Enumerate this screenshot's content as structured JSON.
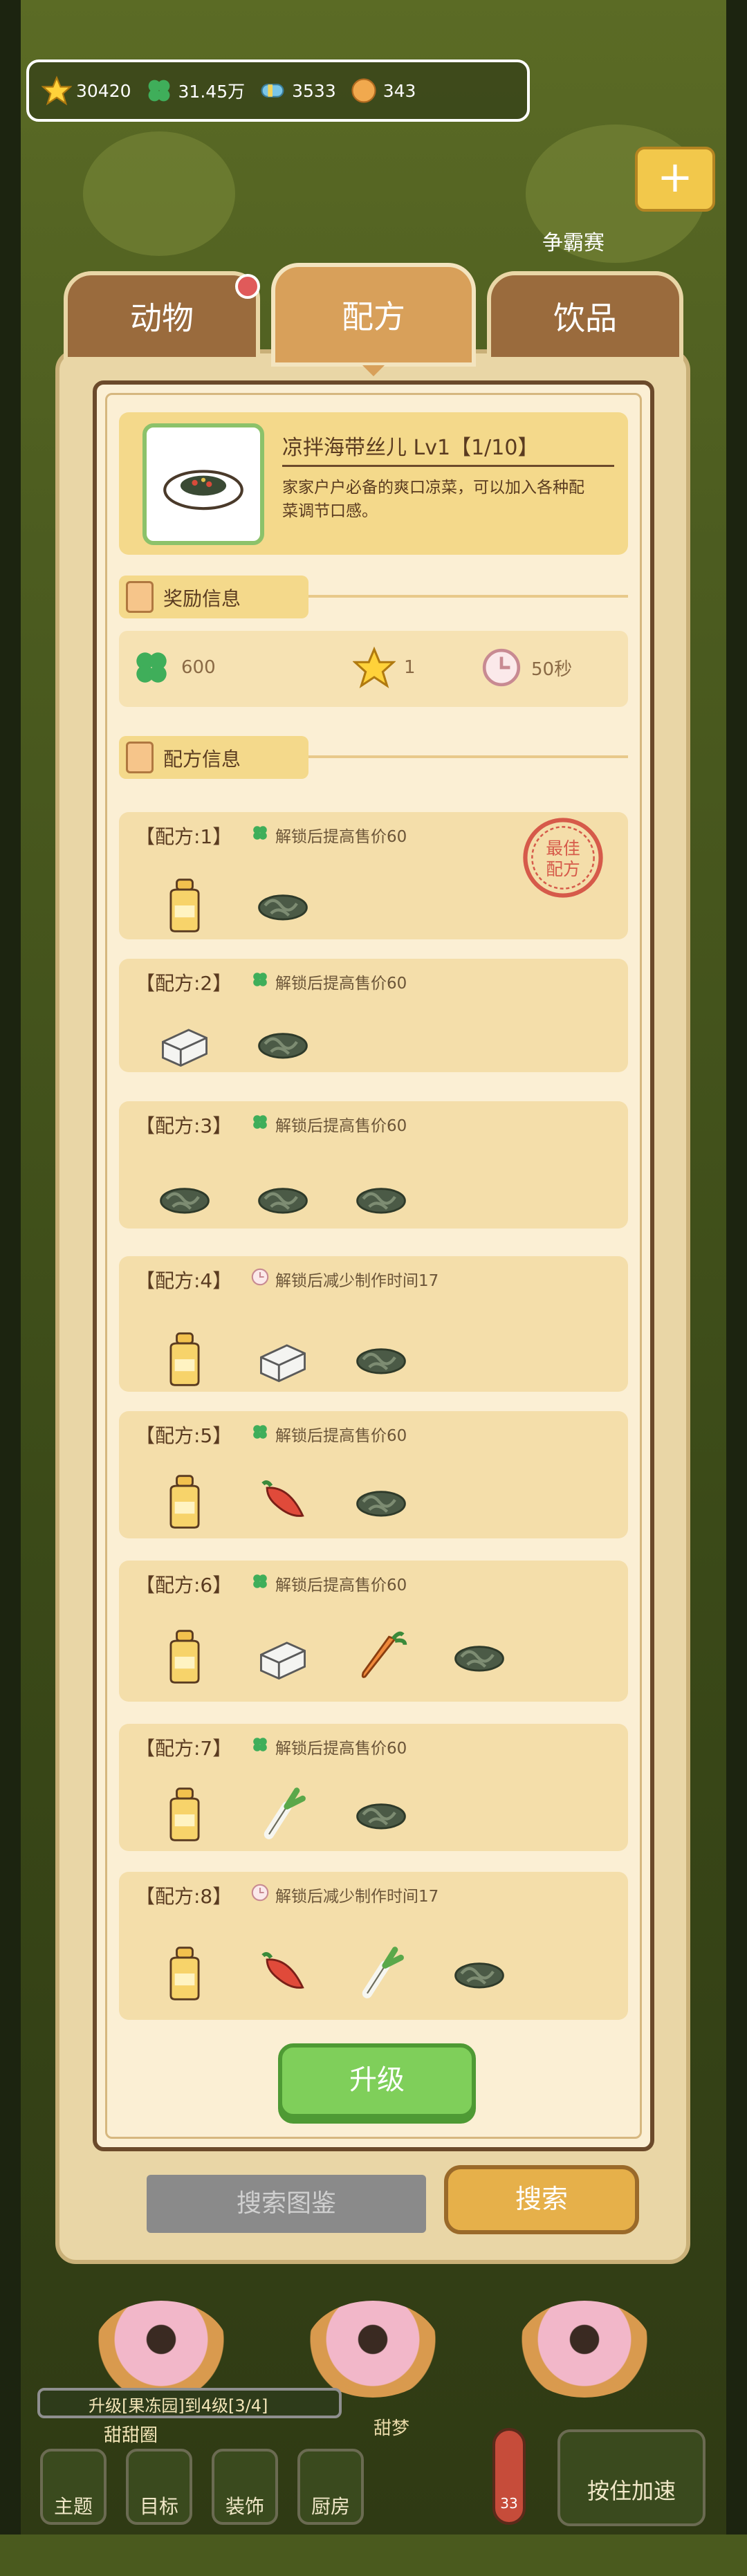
{
  "currency": {
    "stars": "30420",
    "clover": "31.45万",
    "candy": "3533",
    "coin": "343"
  },
  "background": {
    "plus_label": "+",
    "contest_label": "争霸赛"
  },
  "tabs": [
    {
      "label": "动物"
    },
    {
      "label": "配方"
    },
    {
      "label": "饮品"
    }
  ],
  "dish": {
    "title": "凉拌海带丝儿 Lv1【1/10】",
    "description": "家家户户必备的爽口凉菜，可以加入各种配菜调节口感。"
  },
  "reward_section": {
    "label": "奖励信息",
    "clover": "600",
    "star": "1",
    "time": "50秒"
  },
  "recipe_section": {
    "label": "配方信息",
    "best_stamp": "最佳配方",
    "recipes": [
      {
        "title": "【配方:1】",
        "effect": "解锁后提高售价60",
        "effect_icon": "clover-icon",
        "ingredients": [
          "oil-bottle",
          "seaweed"
        ]
      },
      {
        "title": "【配方:2】",
        "effect": "解锁后提高售价60",
        "effect_icon": "clover-icon",
        "ingredients": [
          "tofu",
          "seaweed"
        ]
      },
      {
        "title": "【配方:3】",
        "effect": "解锁后提高售价60",
        "effect_icon": "clover-icon",
        "ingredients": [
          "seaweed",
          "seaweed",
          "seaweed"
        ]
      },
      {
        "title": "【配方:4】",
        "effect": "解锁后减少制作时间17",
        "effect_icon": "clock-icon",
        "ingredients": [
          "oil-bottle",
          "tofu",
          "seaweed"
        ]
      },
      {
        "title": "【配方:5】",
        "effect": "解锁后提高售价60",
        "effect_icon": "clover-icon",
        "ingredients": [
          "oil-bottle",
          "chili",
          "seaweed"
        ]
      },
      {
        "title": "【配方:6】",
        "effect": "解锁后提高售价60",
        "effect_icon": "clover-icon",
        "ingredients": [
          "oil-bottle",
          "tofu",
          "carrot",
          "seaweed"
        ]
      },
      {
        "title": "【配方:7】",
        "effect": "解锁后提高售价60",
        "effect_icon": "clover-icon",
        "ingredients": [
          "oil-bottle",
          "scallion",
          "seaweed"
        ]
      },
      {
        "title": "【配方:8】",
        "effect": "解锁后减少制作时间17",
        "effect_icon": "clock-icon",
        "ingredients": [
          "oil-bottle",
          "chili",
          "scallion",
          "seaweed"
        ]
      }
    ]
  },
  "upgrade_label": "升级",
  "search": {
    "placeholder": "搜索图鉴",
    "button_label": "搜索"
  },
  "hud": {
    "level_text": "升级[果冻园]到4级[3/4]",
    "level_sub": "甜甜圈",
    "dessert_label": "甜梦",
    "nav": [
      "主题",
      "目标",
      "装饰",
      "厨房"
    ],
    "thermo_value": "33",
    "speed_label": "按住加速"
  }
}
